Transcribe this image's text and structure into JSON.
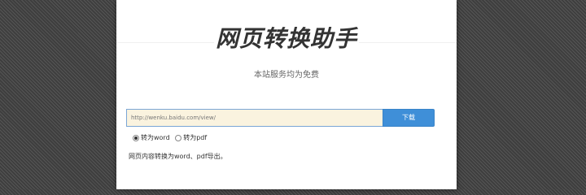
{
  "header": {
    "title": "网页转换助手",
    "subtitle": "本站服务均为免费"
  },
  "form": {
    "url_value": "http://wenku.baidu.com/view/",
    "download_label": "下载",
    "options": [
      {
        "label": "转为word",
        "checked": true
      },
      {
        "label": "转为pdf",
        "checked": false
      }
    ],
    "description": "网页内容转换为word、pdf导出。"
  },
  "colors": {
    "accent": "#3f8fd8",
    "input_bg": "#faf3df"
  }
}
